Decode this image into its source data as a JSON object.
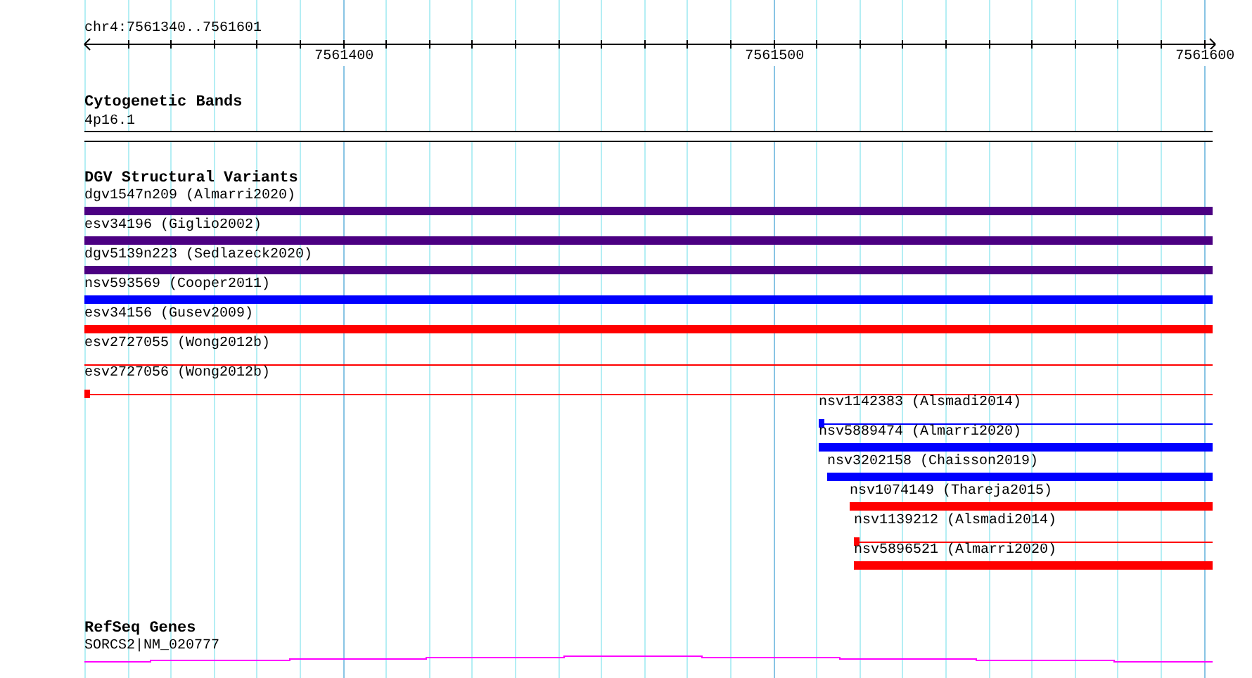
{
  "ruler": {
    "location": "chr4:7561340..7561601",
    "tick_labels": [
      "7561400",
      "7561500",
      "7561600"
    ]
  },
  "cytogenetic_bands": {
    "title": "Cytogenetic Bands",
    "band": "4p16.1"
  },
  "dgv_structural_variants": {
    "title": "DGV Structural Variants",
    "features": [
      {
        "label": "dgv1547n209 (Almarri2020)",
        "kind": "bar",
        "color": "#4b0082"
      },
      {
        "label": "esv34196 (Giglio2002)",
        "kind": "bar",
        "color": "#4b0082"
      },
      {
        "label": "dgv5139n223 (Sedlazeck2020)",
        "kind": "bar",
        "color": "#4b0082"
      },
      {
        "label": "nsv593569 (Cooper2011)",
        "kind": "bar",
        "color": "#0000ff"
      },
      {
        "label": "esv34156 (Gusev2009)",
        "kind": "bar",
        "color": "#ff0000"
      },
      {
        "label": "esv2727055 (Wong2012b)",
        "kind": "line",
        "color": "#ff0000"
      },
      {
        "label": "esv2727056 (Wong2012b)",
        "kind": "line-block",
        "color": "#ff0000"
      },
      {
        "label": "nsv1142383 (Alsmadi2014)",
        "kind": "line-block",
        "color": "#0000ff"
      },
      {
        "label": "nsv5889474 (Almarri2020)",
        "kind": "bar",
        "color": "#0000ff"
      },
      {
        "label": "nsv3202158 (Chaisson2019)",
        "kind": "bar",
        "color": "#0000ff"
      },
      {
        "label": "nsv1074149 (Thareja2015)",
        "kind": "bar",
        "color": "#ff0000"
      },
      {
        "label": "nsv1139212 (Alsmadi2014)",
        "kind": "line-block",
        "color": "#ff0000"
      },
      {
        "label": "nsv5896521 (Almarri2020)",
        "kind": "bar",
        "color": "#ff0000"
      }
    ]
  },
  "refseq_genes": {
    "title": "RefSeq Genes",
    "gene": "SORCS2|NM_020777"
  }
}
